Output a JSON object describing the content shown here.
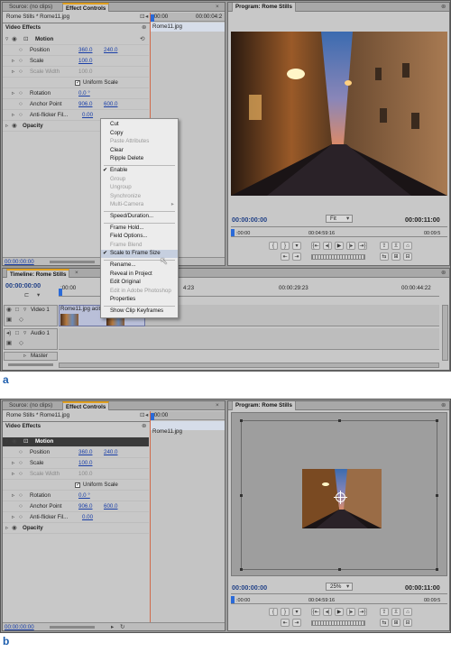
{
  "source_tab": "Source: (no clips)",
  "effect_tab": "Effect Controls",
  "program_tab": "Program: Rome Stills",
  "clip_path": "Rome Stills * Rome11.jpg",
  "clip_name": "Rome11.jpg",
  "video_effects": "Video Effects",
  "motion": "Motion",
  "position_label": "Position",
  "position_x": "360.0",
  "position_y": "240.0",
  "scale_label": "Scale",
  "scale_val": "100.0",
  "scale_width_label": "Scale Width",
  "scale_width_val": "100.0",
  "uniform_scale": "Uniform Scale",
  "rotation_label": "Rotation",
  "rotation_val": "0.0 °",
  "anchor_label": "Anchor Point",
  "anchor_x": "906.0",
  "anchor_y": "600.0",
  "antiflicker_label": "Anti-flicker Fil...",
  "antiflicker_val": "0.00",
  "opacity": "Opacity",
  "ec_ruler_tc": ":00:00",
  "ec_ruler_tc2": "00:00:04:2",
  "ec_time": "00:00:00:00",
  "program_time": "00:00:00:00",
  "program_duration": "00:00:11:00",
  "fit_a": "Fit",
  "fit_b": "25%",
  "ruler_mid": "00:04:59:16",
  "ruler_end": "00:09:5",
  "timeline_tab": "Timeline: Rome Stills",
  "timeline_time": "00:00:00:00",
  "tl_ruler": [
    ":00:00",
    "00:00:14:23",
    "00:00:29:23",
    "00:00:44:22"
  ],
  "tl_ruler_2": "4:23",
  "video1": "Video 1",
  "audio1": "Audio 1",
  "master": "Master",
  "clip_on_track": "Rome11.jpg acity",
  "menu": [
    {
      "label": "Cut",
      "disabled": false,
      "check": false
    },
    {
      "label": "Copy",
      "disabled": false,
      "check": false
    },
    {
      "label": "Paste Attributes",
      "disabled": true,
      "check": false
    },
    {
      "label": "Clear",
      "disabled": false,
      "check": false
    },
    {
      "label": "Ripple Delete",
      "disabled": false,
      "check": false
    },
    {
      "label": "Enable",
      "disabled": false,
      "check": true
    },
    {
      "label": "Group",
      "disabled": true,
      "check": false
    },
    {
      "label": "Ungroup",
      "disabled": true,
      "check": false
    },
    {
      "label": "Synchronize",
      "disabled": true,
      "check": false
    },
    {
      "label": "Multi-Camera",
      "disabled": true,
      "check": false
    },
    {
      "label": "Speed/Duration...",
      "disabled": false,
      "check": false
    },
    {
      "label": "Frame Hold...",
      "disabled": false,
      "check": false
    },
    {
      "label": "Field Options...",
      "disabled": false,
      "check": false
    },
    {
      "label": "Frame Blend",
      "disabled": true,
      "check": false
    },
    {
      "label": "Scale to Frame Size",
      "disabled": false,
      "check": true
    },
    {
      "label": "Rename...",
      "disabled": false,
      "check": false
    },
    {
      "label": "Reveal in Project",
      "disabled": false,
      "check": false
    },
    {
      "label": "Edit Original",
      "disabled": false,
      "check": false
    },
    {
      "label": "Edit in Adobe Photoshop",
      "disabled": true,
      "check": false
    },
    {
      "label": "Properties",
      "disabled": false,
      "check": false
    },
    {
      "label": "Show Clip Keyframes",
      "disabled": false,
      "check": false
    }
  ],
  "label_a": "a",
  "label_b": "b",
  "colors": {
    "accent": "#1f3f86",
    "panel": "#c8c8c8",
    "tab_highlight": "#e0a020"
  }
}
